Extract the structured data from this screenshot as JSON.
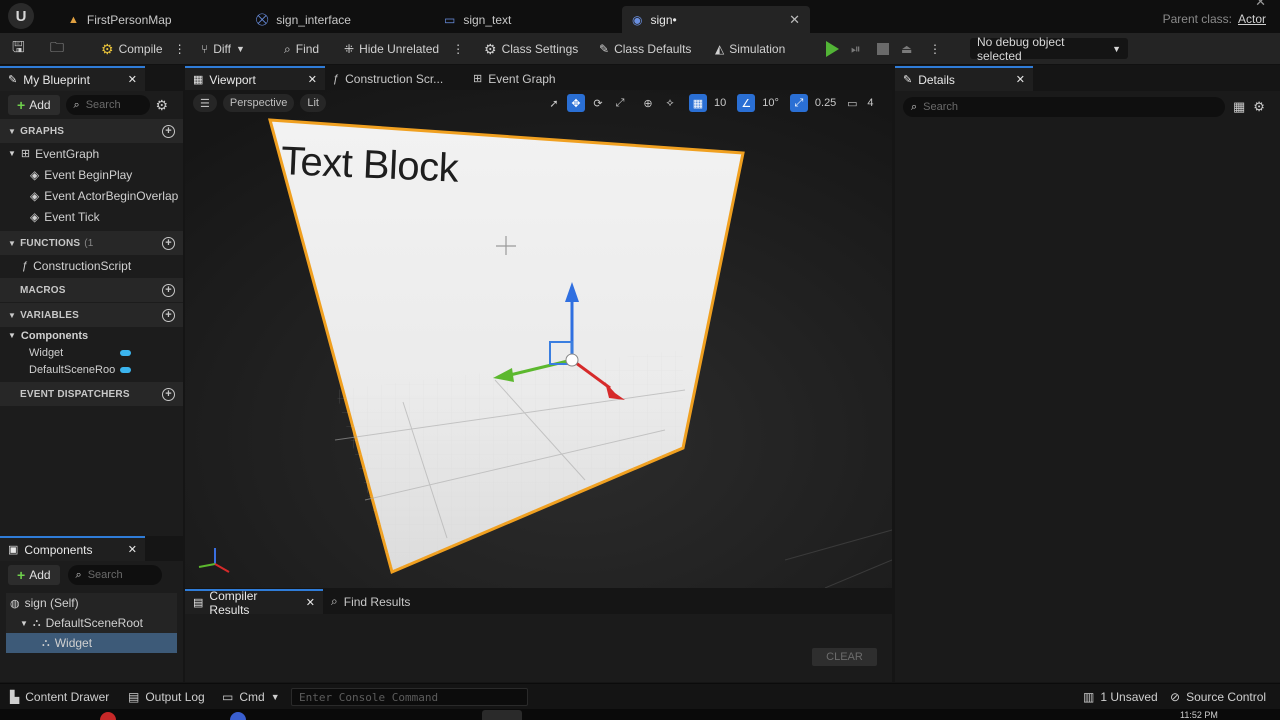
{
  "tabs": [
    {
      "label": "FirstPersonMap",
      "active": false
    },
    {
      "label": "sign_interface",
      "active": false
    },
    {
      "label": "sign_text",
      "active": false
    },
    {
      "label": "sign•",
      "active": true
    }
  ],
  "parent_class": {
    "label": "Parent class:",
    "value": "Actor"
  },
  "toolbar": {
    "compile": "Compile",
    "diff": "Diff",
    "find": "Find",
    "hide_unrelated": "Hide Unrelated",
    "class_settings": "Class Settings",
    "class_defaults": "Class Defaults",
    "simulation": "Simulation",
    "debug_select": "No debug object selected"
  },
  "my_blueprint": {
    "title": "My Blueprint",
    "add": "Add",
    "search_placeholder": "Search",
    "graphs_header": "GRAPHS",
    "event_graph": "EventGraph",
    "events": [
      "Event BeginPlay",
      "Event ActorBeginOverlap",
      "Event Tick"
    ],
    "functions_header": "FUNCTIONS",
    "functions_count": "(1",
    "construction_script": "ConstructionScript",
    "macros_header": "MACROS",
    "variables_header": "VARIABLES",
    "components_label": "Components",
    "variables": [
      "Widget",
      "DefaultSceneRoo"
    ],
    "dispatchers_header": "EVENT DISPATCHERS"
  },
  "components_panel": {
    "title": "Components",
    "add": "Add",
    "search_placeholder": "Search",
    "self": "sign (Self)",
    "root": "DefaultSceneRoot",
    "widget": "Widget"
  },
  "editor_tabs": [
    "Viewport",
    "Construction Scr...",
    "Event Graph"
  ],
  "viewport": {
    "perspective": "Perspective",
    "lit": "Lit",
    "grid_snap": "10",
    "rot_snap": "10°",
    "scale_snap": "0.25",
    "camera_speed": "4",
    "widget_text": "Text Block"
  },
  "results_tabs": [
    "Compiler Results",
    "Find Results"
  ],
  "clear_button": "CLEAR",
  "details": {
    "title": "Details",
    "search_placeholder": "Search"
  },
  "statusbar": {
    "content_drawer": "Content Drawer",
    "output_log": "Output Log",
    "cmd": "Cmd",
    "console_placeholder": "Enter Console Command",
    "unsaved": "1 Unsaved",
    "source_control": "Source Control"
  },
  "clock": "11:52 PM",
  "colors": {
    "accent": "#2f7cd8",
    "play": "#52b436",
    "selection_outline": "#f0a020"
  }
}
